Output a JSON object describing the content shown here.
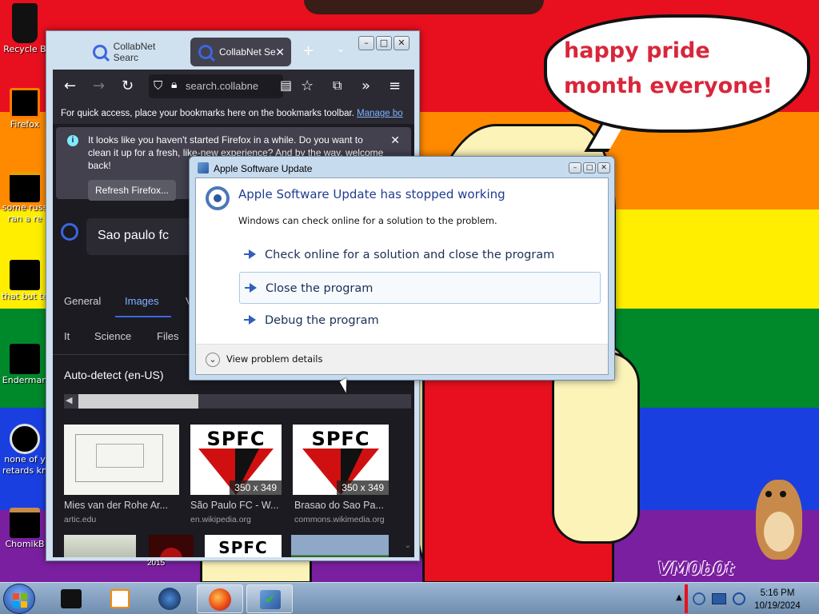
{
  "desktop": {
    "icons": [
      {
        "label": "Recycle B"
      },
      {
        "label": "Firefox"
      },
      {
        "label": "some russ\nran a re"
      },
      {
        "label": "that but te"
      },
      {
        "label": "Enderman"
      },
      {
        "label": "none of y\nretards kn"
      },
      {
        "label": "ChomikB"
      }
    ],
    "speech_bubble": "happy pride month everyone!",
    "watermark": "VM0b0t",
    "flag_colors": [
      "#e8101e",
      "#ff8a00",
      "#ffee00",
      "#00892b",
      "#1a3fe0",
      "#7a1fa0"
    ]
  },
  "firefox": {
    "tabs": [
      {
        "label": "CollabNet Searc"
      },
      {
        "label": "CollabNet Se"
      }
    ],
    "url": "search.collabne",
    "bookmarks_text": "For quick access, place your bookmarks here on the bookmarks toolbar.",
    "bookmarks_link": "Manage bo",
    "notice": {
      "text": "It looks like you haven't started Firefox in a while. Do you want to clean it up for a fresh, like-new experience? And by the way, welcome back!",
      "button": "Refresh Firefox..."
    },
    "search_query": "Sao paulo fc",
    "nav_tabs": [
      {
        "label": "General"
      },
      {
        "label": "Images"
      },
      {
        "label": "V"
      }
    ],
    "categories": [
      {
        "label": "It"
      },
      {
        "label": "Science"
      },
      {
        "label": "Files"
      }
    ],
    "language": "Auto-detect (en-US)",
    "results": [
      {
        "title": "Mies van der Rohe Ar...",
        "source": "artic.edu",
        "dims": ""
      },
      {
        "title": "São Paulo FC - W...",
        "source": "en.wikipedia.org",
        "dims": "350 x 349"
      },
      {
        "title": "Brasao do Sao Pa...",
        "source": "commons.wikimedia.org",
        "dims": "350 x 349"
      }
    ],
    "row2_caption": "2015",
    "spfc_letters": "SPFC"
  },
  "dialog": {
    "title": "Apple Software Update",
    "heading": "Apple Software Update has stopped working",
    "subtext": "Windows can check online for a solution to the problem.",
    "options": [
      {
        "label": "Check online for a solution and close the program"
      },
      {
        "label": "Close the program"
      },
      {
        "label": "Debug the program"
      }
    ],
    "details": "View problem details"
  },
  "taskbar": {
    "time": "5:16 PM",
    "date": "10/19/2024"
  }
}
